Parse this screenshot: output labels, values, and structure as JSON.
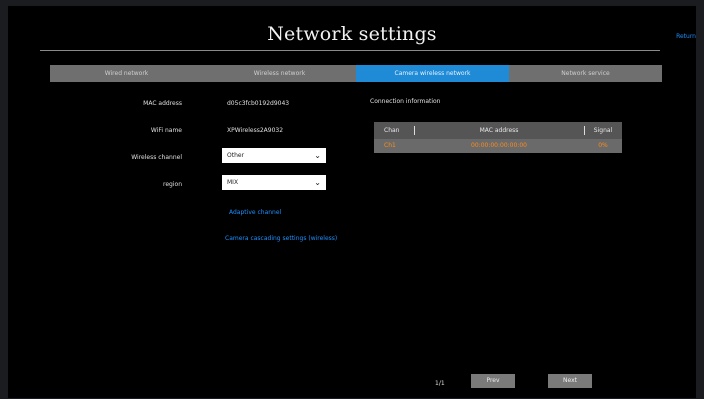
{
  "header": {
    "title": "Network settings",
    "return_label": "Return"
  },
  "tabs": [
    {
      "label": "Wired network"
    },
    {
      "label": "Wireless network"
    },
    {
      "label": "Camera wireless network"
    },
    {
      "label": "Network service"
    }
  ],
  "form": {
    "mac": {
      "label": "MAC address",
      "value": "d05c3fcb0192d9043"
    },
    "wifi": {
      "label": "WiFi name",
      "value": "XPWireless2A9032"
    },
    "channel": {
      "label": "Wireless channel",
      "value": "Other"
    },
    "region": {
      "label": "region",
      "value": "MIX"
    },
    "adapt_link": "Adaptive channel",
    "camera_link": "Camera cascading settings (wireless)"
  },
  "connection": {
    "title": "Connection information",
    "columns": [
      "Chan",
      "MAC address",
      "Signal"
    ],
    "rows": [
      {
        "chan": "Ch1",
        "mac": "00:00:00:00:00:00",
        "signal": "0%"
      }
    ]
  },
  "pager": {
    "page": "1/1",
    "prev_label": "Prev",
    "next_label": "Next"
  }
}
